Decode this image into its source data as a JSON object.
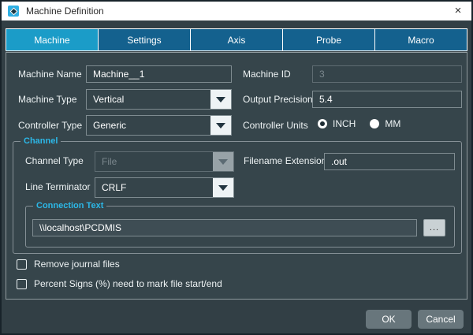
{
  "window": {
    "title": "Machine Definition",
    "close_label": "×"
  },
  "tabs": [
    {
      "label": "Machine",
      "active": true
    },
    {
      "label": "Settings",
      "active": false
    },
    {
      "label": "Axis",
      "active": false
    },
    {
      "label": "Probe",
      "active": false
    },
    {
      "label": "Macro",
      "active": false
    }
  ],
  "form": {
    "machine_name": {
      "label": "Machine Name",
      "value": "Machine__1"
    },
    "machine_id": {
      "label": "Machine ID",
      "value": "3",
      "disabled": true
    },
    "machine_type": {
      "label": "Machine Type",
      "value": "Vertical"
    },
    "output_precision": {
      "label": "Output Precision",
      "value": "5.4"
    },
    "controller_type": {
      "label": "Controller Type",
      "value": "Generic"
    },
    "controller_units": {
      "label": "Controller Units",
      "options": [
        {
          "label": "INCH",
          "selected": true
        },
        {
          "label": "MM",
          "selected": false
        }
      ]
    }
  },
  "channel_group": {
    "title": "Channel",
    "channel_type": {
      "label": "Channel Type",
      "value": "File",
      "disabled": true
    },
    "filename_extension": {
      "label": "Filename Extension",
      "value": ".out"
    },
    "line_terminator": {
      "label": "Line Terminator",
      "value": "CRLF"
    },
    "connection_group": {
      "title": "Connection Text",
      "value": "\\\\localhost\\PCDMIS",
      "browse_label": "..."
    }
  },
  "checkboxes": [
    {
      "label": "Remove journal files",
      "checked": false
    },
    {
      "label": "Percent Signs (%) need to mark file start/end",
      "checked": false
    }
  ],
  "footer": {
    "ok_label": "OK",
    "cancel_label": "Cancel"
  },
  "colors": {
    "active_tab": "#1b9cc8",
    "inactive_tab": "#14618e",
    "panel_bg": "#36454b",
    "group_label": "#2cb8e8",
    "titlebar_bg": "#ffffff",
    "button_bg": "#68767c"
  }
}
